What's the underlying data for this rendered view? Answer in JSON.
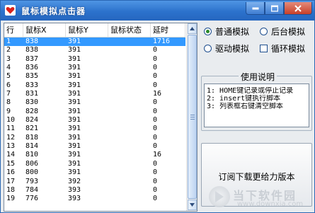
{
  "window": {
    "title": "鼠标模拟点击器"
  },
  "table": {
    "headers": [
      "行",
      "鼠标X",
      "鼠标Y",
      "鼠标状态",
      "延时"
    ],
    "rows": [
      [
        "1",
        "838",
        "391",
        "",
        "1716"
      ],
      [
        "2",
        "838",
        "391",
        "",
        "0"
      ],
      [
        "3",
        "837",
        "391",
        "",
        "0"
      ],
      [
        "4",
        "836",
        "391",
        "",
        "0"
      ],
      [
        "5",
        "835",
        "391",
        "",
        "0"
      ],
      [
        "6",
        "833",
        "391",
        "",
        "0"
      ],
      [
        "7",
        "831",
        "391",
        "",
        "16"
      ],
      [
        "8",
        "830",
        "391",
        "",
        "0"
      ],
      [
        "9",
        "828",
        "391",
        "",
        "0"
      ],
      [
        "10",
        "824",
        "391",
        "",
        "0"
      ],
      [
        "11",
        "821",
        "391",
        "",
        "0"
      ],
      [
        "12",
        "818",
        "391",
        "",
        "0"
      ],
      [
        "13",
        "814",
        "391",
        "",
        "0"
      ],
      [
        "14",
        "810",
        "391",
        "",
        "16"
      ],
      [
        "15",
        "806",
        "391",
        "",
        "0"
      ],
      [
        "16",
        "800",
        "391",
        "",
        "0"
      ],
      [
        "17",
        "793",
        "392",
        "",
        "0"
      ],
      [
        "18",
        "784",
        "393",
        "",
        "0"
      ],
      [
        "19",
        "776",
        "393",
        "",
        "0"
      ]
    ]
  },
  "options": {
    "normal": "普通模拟",
    "background": "后台模拟",
    "driver": "驱动模拟",
    "loop": "循环模拟"
  },
  "help": {
    "title": "使用说明",
    "lines": [
      "1: HOME键记录或停止记录",
      "2: insert键执行脚本",
      "3: 列表框右键清空脚本"
    ]
  },
  "button": {
    "label": "订阅下载更给力版本"
  },
  "watermark": {
    "title": "当下软件园",
    "url": "www.downxia.com"
  }
}
